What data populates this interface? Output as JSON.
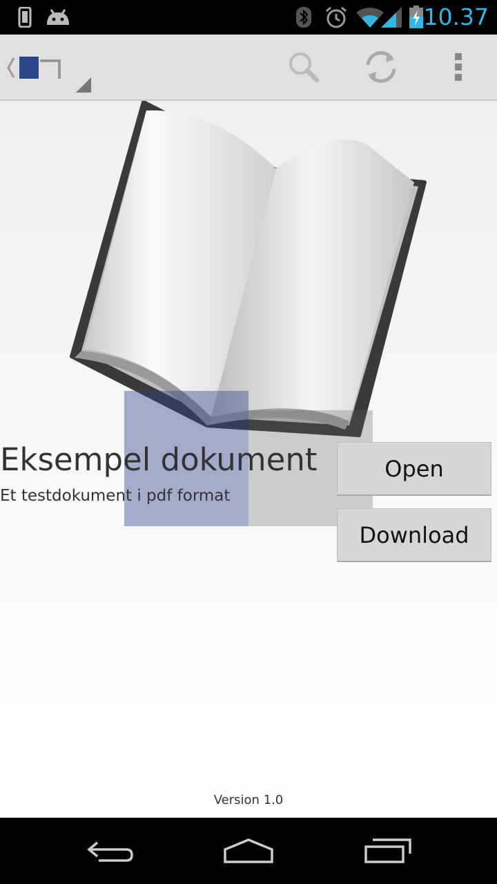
{
  "status_bar": {
    "time": "10.37",
    "icons": [
      "phone-icon",
      "android-icon",
      "bluetooth-icon",
      "alarm-icon",
      "wifi-icon",
      "signal-icon",
      "battery-charging-icon"
    ],
    "time_color": "#33b5e5"
  },
  "action_bar": {
    "icons": [
      "back-caret-icon",
      "app-logo-icon",
      "search-icon",
      "refresh-icon",
      "overflow-menu-icon"
    ],
    "background": "#e0e0e0"
  },
  "document": {
    "title": "Eksempel dokument",
    "subtitle": "Et testdokument i pdf format",
    "open_label": "Open",
    "download_label": "Download"
  },
  "footer": {
    "version": "Version 1.0"
  },
  "nav_bar": {
    "icons": [
      "back-icon",
      "home-icon",
      "recents-icon"
    ]
  }
}
